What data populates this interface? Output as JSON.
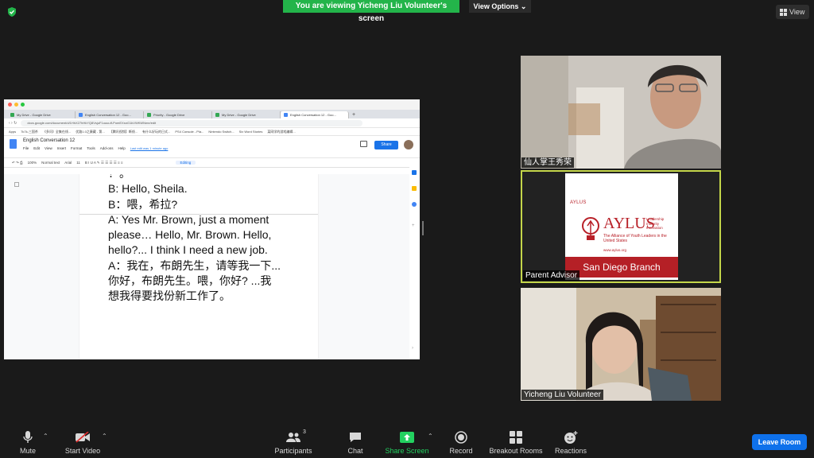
{
  "banner": {
    "text": "You are viewing Yicheng Liu Volunteer's screen"
  },
  "view_options": {
    "label": "View Options ⌄"
  },
  "view_button": {
    "label": "View"
  },
  "browser": {
    "tabs": [
      {
        "label": "My Drive - Google Drive"
      },
      {
        "label": "English Conversation 12 - Goo..."
      },
      {
        "label": "Priority - Google Drive"
      },
      {
        "label": "My Drive - Google Drive"
      },
      {
        "label": "English Conversation 12 - Goo..."
      }
    ],
    "url": "docs.google.com/document/d/1HhX27hHkYQ8VsjuF1ouuuIf-PomEXsnG1kVWKWNme/edit",
    "bookmarks": [
      "Apps",
      "7k7k-三国杀",
      "《多问》全集在线...",
      "优路1.0之康藏 - 第...",
      "【腾讯视频】断线...",
      "有什么好玩的日式...",
      "PS4 Console - Pla...",
      "Nintendo Switch...",
      "Six Word Stories",
      "某网学的游戏编辑..."
    ]
  },
  "doc": {
    "title": "English Conversation 12",
    "menu": [
      "File",
      "Edit",
      "View",
      "Insert",
      "Format",
      "Tools",
      "Add-ons",
      "Help"
    ],
    "last_edit": "Last edit was 1 minute ago",
    "share_label": "Share",
    "toolbar": {
      "zoom": "100%",
      "style": "Normal text",
      "font": "Arial",
      "size": "11",
      "mode": "Editing"
    },
    "lines": {
      "l0": "！。",
      "l1": "B: Hello, Sheila.",
      "l2": "B：喂，希拉?",
      "l3": "A: Yes Mr. Brown, just a moment",
      "l4": "please… Hello, Mr. Brown. Hello,",
      "l5": "hello?... I think I need a new job.",
      "l6": "A：我在，布朗先生，请等我一下...",
      "l7": "你好，布朗先生。喂，你好? ...我",
      "l8": "想我得要找份新工作了。"
    }
  },
  "participants": {
    "tile1": {
      "name": "仙人掌王秀荣"
    },
    "tile2": {
      "name": "Parent Advisor",
      "card": {
        "small_logo": "AYLUS",
        "logo": "AYLUS",
        "tagline": "Leadership Integrity Innovation",
        "subtitle": "The Alliance of Youth Leaders in the United States",
        "website": "www.aylus.org",
        "branch": "San Diego Branch"
      }
    },
    "tile3": {
      "name": "Yicheng Liu Volunteer"
    }
  },
  "controls": {
    "mute": "Mute",
    "start_video": "Start Video",
    "participants": "Participants",
    "participants_count": "3",
    "chat": "Chat",
    "share_screen": "Share Screen",
    "record": "Record",
    "breakout_rooms": "Breakout Rooms",
    "reactions": "Reactions",
    "leave": "Leave Room"
  },
  "colors": {
    "banner": "#23b44a",
    "active_speaker": "#c4d64a",
    "leave": "#0e71eb",
    "aylus_red": "#b52026"
  }
}
